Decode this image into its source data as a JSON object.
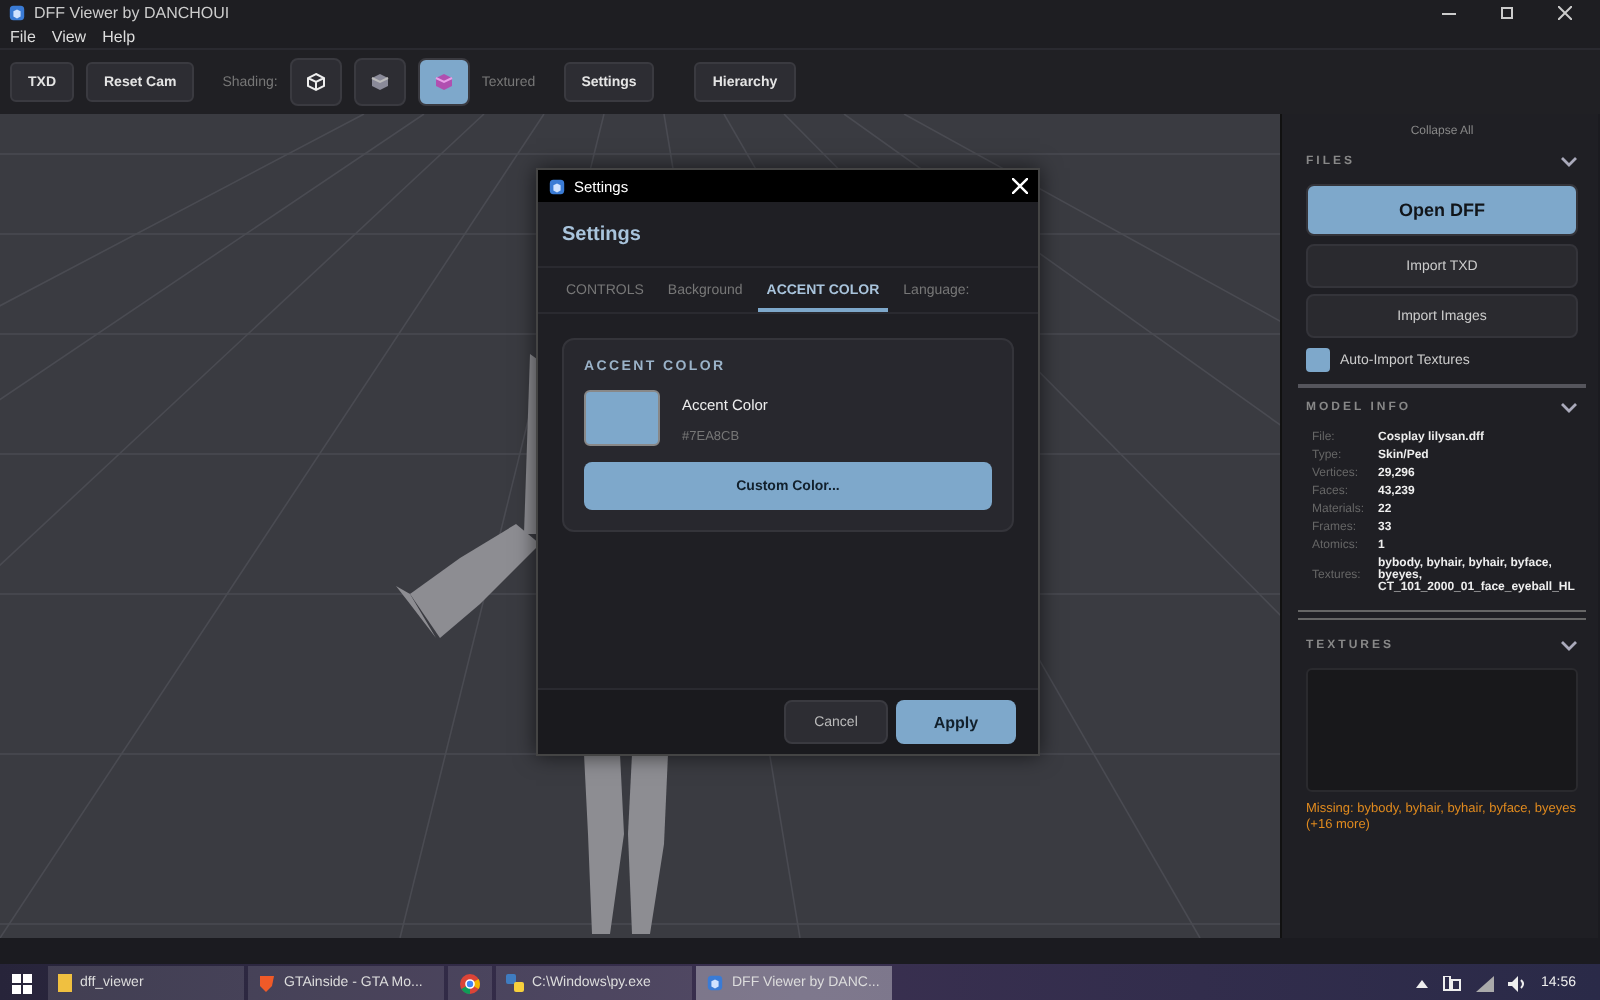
{
  "window": {
    "title": "DFF Viewer by DANCHOUI"
  },
  "menu": [
    "File",
    "View",
    "Help"
  ],
  "toolbar": {
    "buttons_left": [
      "TXD",
      "Reset Cam"
    ],
    "shading_label": "Shading:",
    "shading_modes": [
      {
        "kind": "wire",
        "selected": false
      },
      {
        "kind": "solid",
        "selected": false
      },
      {
        "kind": "textured",
        "selected": true
      }
    ],
    "mode_label": "Textured",
    "buttons_right": [
      "Settings",
      "Hierarchy"
    ]
  },
  "dialog": {
    "title": "Settings",
    "heading": "Settings",
    "tabs": [
      {
        "label": "CONTROLS",
        "selected": false
      },
      {
        "label": "Background",
        "selected": false
      },
      {
        "label": "ACCENT COLOR",
        "selected": true
      },
      {
        "label": "Language:",
        "selected": false
      }
    ],
    "section_title": "ACCENT COLOR",
    "swatch_label": "Accent Color",
    "swatch_value": "#7EA8CB",
    "custom_button": "Custom Color...",
    "cancel": "Cancel",
    "apply": "Apply"
  },
  "sidebar": {
    "collapse_all": "Collapse All",
    "files": {
      "title": "FILES",
      "buttons": [
        {
          "label": "Open DFF",
          "primary": true
        },
        {
          "label": "Import TXD",
          "primary": false
        },
        {
          "label": "Import Images",
          "primary": false
        }
      ],
      "auto_import": {
        "label": "Auto-Import Textures",
        "checked": true
      }
    },
    "model_info": {
      "title": "MODEL INFO",
      "rows": [
        {
          "label": "File:",
          "value": "Cosplay lilysan.dff"
        },
        {
          "label": "Type:",
          "value": "Skin/Ped"
        },
        {
          "label": "Vertices:",
          "value": "29,296"
        },
        {
          "label": "Faces:",
          "value": "43,239"
        },
        {
          "label": "Materials:",
          "value": "22"
        },
        {
          "label": "Frames:",
          "value": "33"
        },
        {
          "label": "Atomics:",
          "value": "1"
        },
        {
          "label": "Textures:",
          "value": "bybody, byhair, byhair, byface, byeyes, CT_101_2000_01_face_eyeball_HL"
        }
      ]
    },
    "textures": {
      "title": "TEXTURES",
      "missing": "Missing: bybody, byhair, byhair, byface, byeyes (+16 more)"
    }
  },
  "taskbar": {
    "items": [
      {
        "kind": "folder",
        "label": "dff_viewer",
        "selected": false
      },
      {
        "kind": "shield",
        "label": "GTAinside - GTA Mo...",
        "selected": false
      },
      {
        "kind": "chrome",
        "selected": false
      },
      {
        "kind": "python",
        "label": "C:\\Windows\\py.exe",
        "selected": false
      },
      {
        "kind": "app",
        "label": "DFF Viewer by DANC...",
        "selected": true
      }
    ],
    "clock": "14:56"
  }
}
